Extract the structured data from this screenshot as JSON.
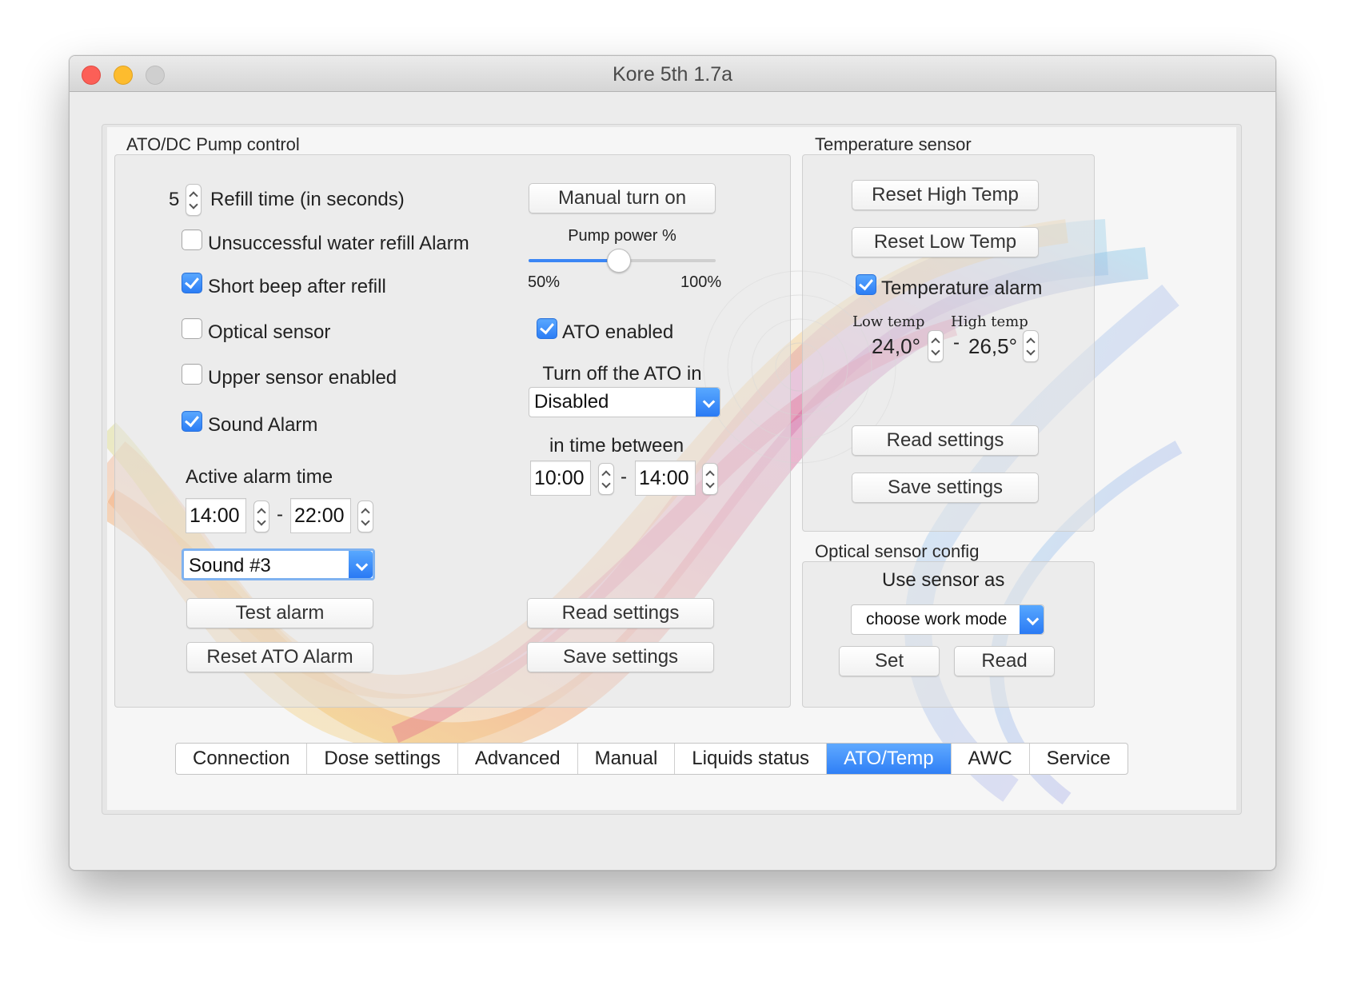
{
  "window": {
    "title": "Kore 5th 1.7a"
  },
  "ato": {
    "group_title": "ATO/DC Pump control",
    "refill_value": "5",
    "refill_label": "Refill time (in seconds)",
    "unsuccessful_label": "Unsuccessful water refill Alarm",
    "unsuccessful_checked": false,
    "short_beep_label": "Short beep after refill",
    "short_beep_checked": true,
    "optical_label": "Optical sensor",
    "optical_checked": false,
    "upper_label": "Upper sensor enabled",
    "upper_checked": false,
    "sound_alarm_label": "Sound Alarm",
    "sound_alarm_checked": true,
    "active_alarm_label": "Active alarm time",
    "alarm_from": "14:00",
    "dash": "-",
    "alarm_to": "22:00",
    "sound_value": "Sound #3",
    "test_alarm": "Test alarm",
    "reset_ato_alarm": "Reset ATO Alarm",
    "manual_turn_on": "Manual turn on",
    "pump_power_label": "Pump power %",
    "pump_power_min": "50%",
    "pump_power_max": "100%",
    "pump_power_level": 0.48,
    "ato_enabled_label": "ATO enabled",
    "ato_enabled_checked": true,
    "turn_off_label": "Turn off the ATO in",
    "turn_off_value": "Disabled",
    "in_time_between": "in time between",
    "time_from": "10:00",
    "time_to": "14:00",
    "read_settings": "Read settings",
    "save_settings": "Save settings"
  },
  "temp": {
    "group_title": "Temperature sensor",
    "reset_high": "Reset High Temp",
    "reset_low": "Reset Low Temp",
    "alarm_label": "Temperature alarm",
    "alarm_checked": true,
    "low_label": "Low temp",
    "high_label": "High temp",
    "low_value": "24,0°",
    "high_value": "26,5°",
    "dash": "-",
    "read_settings": "Read settings",
    "save_settings": "Save settings"
  },
  "optical": {
    "group_title": "Optical sensor config",
    "use_as_label": "Use sensor as",
    "mode_value": "choose work mode",
    "set_button": "Set",
    "read_button": "Read"
  },
  "tabs": [
    {
      "label": "Connection",
      "active": false
    },
    {
      "label": "Dose settings",
      "active": false
    },
    {
      "label": "Advanced",
      "active": false
    },
    {
      "label": "Manual",
      "active": false
    },
    {
      "label": "Liquids status",
      "active": false
    },
    {
      "label": "ATO/Temp",
      "active": true
    },
    {
      "label": "AWC",
      "active": false
    },
    {
      "label": "Service",
      "active": false
    }
  ],
  "colors": {
    "accent": "#2f7ff6",
    "close": "#fc5f57",
    "minimize": "#fdbc2e",
    "maximize": "#cfcfcf"
  }
}
